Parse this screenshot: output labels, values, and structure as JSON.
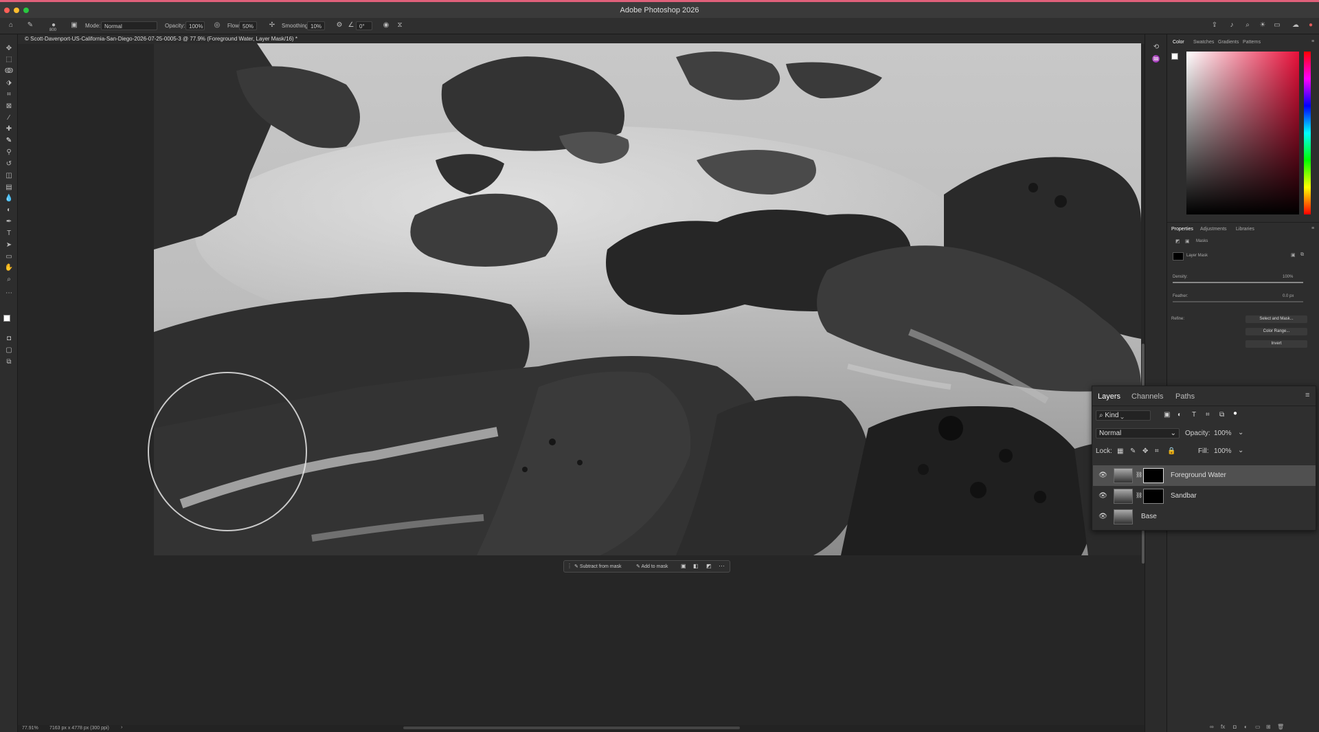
{
  "app": {
    "title": "Adobe Photoshop 2026"
  },
  "options": {
    "mode_label": "Mode:",
    "mode_value": "Normal",
    "opacity_label": "Opacity:",
    "opacity_value": "100%",
    "flow_label": "Flow:",
    "flow_value": "50%",
    "smoothing_label": "Smoothing:",
    "smoothing_value": "10%",
    "angle_value": "0°",
    "brush_size": "800"
  },
  "document": {
    "tab_title": "© Scott-Davenport-US-California-San-Diego-2026-07-25-0005-3 @ 77.9% (Foreground Water, Layer Mask/16) *"
  },
  "context_bar": {
    "subtract_label": "Subtract from mask",
    "add_label": "Add to mask"
  },
  "status": {
    "zoom": "77.91%",
    "doc_info": "7163 px x 4778 px (300 ppi)"
  },
  "color_panel": {
    "tabs": [
      "Color",
      "Swatches",
      "Gradients",
      "Patterns"
    ]
  },
  "properties_panel": {
    "tabs": [
      "Properties",
      "Adjustments",
      "Libraries"
    ],
    "section_label": "Masks",
    "mask_label": "Layer Mask",
    "density_label": "Density:",
    "density_value": "100%",
    "density_fraction": 1.0,
    "feather_label": "Feather:",
    "feather_value": "0.0 px",
    "refine_label": "Refine:",
    "select_and_mask": "Select and Mask...",
    "color_range": "Color Range...",
    "invert": "Invert"
  },
  "layers_panel": {
    "tabs": [
      "Layers",
      "Channels",
      "Paths"
    ],
    "filter_value": "Kind",
    "blend_mode": "Normal",
    "opacity_label": "Opacity:",
    "opacity_value": "100%",
    "lock_label": "Lock:",
    "fill_label": "Fill:",
    "fill_value": "100%",
    "layers": [
      {
        "name": "Foreground Water",
        "selected": true,
        "has_mask": true
      },
      {
        "name": "Sandbar",
        "selected": false,
        "has_mask": true
      },
      {
        "name": "Base",
        "selected": false,
        "has_mask": false
      }
    ]
  },
  "colors": {
    "accent_bar": "#e0607a",
    "traffic_red": "#ff5f57",
    "traffic_yellow": "#febc2e",
    "traffic_green": "#28c840"
  }
}
